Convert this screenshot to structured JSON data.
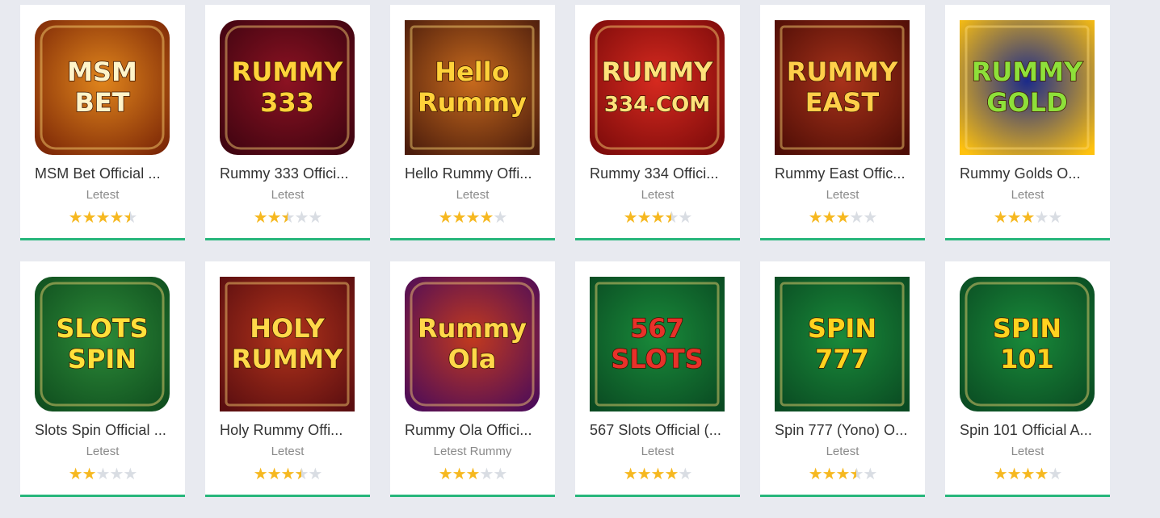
{
  "apps": [
    {
      "title": "MSM Bet Official ...",
      "sub": "Letest",
      "rating": 4.5,
      "art": "MSM BET",
      "bg1": "#7a2506",
      "bg2": "#e0851c",
      "fg": "#fff4c9",
      "shape": "round"
    },
    {
      "title": "Rummy 333 Offici...",
      "sub": "Letest",
      "rating": 2.5,
      "art": "RUMMY 333",
      "bg1": "#3d0410",
      "bg2": "#8c1222",
      "fg": "#ffd23a",
      "shape": "round"
    },
    {
      "title": "Hello Rummy Offi...",
      "sub": "Letest",
      "rating": 4,
      "art": "Hello Rummy",
      "bg1": "#4b1c0c",
      "bg2": "#c76a1d",
      "fg": "#ffd23a",
      "shape": "square"
    },
    {
      "title": "Rummy 334 Offici...",
      "sub": "Letest",
      "rating": 3.5,
      "art": "RUMMY 334.COM",
      "bg1": "#7a0a0a",
      "bg2": "#d62a1f",
      "fg": "#ffe27a",
      "shape": "round"
    },
    {
      "title": "Rummy East Offic...",
      "sub": "Letest",
      "rating": 3,
      "art": "RUMMY EAST",
      "bg1": "#4d0d06",
      "bg2": "#a8321a",
      "fg": "#ffcf4a",
      "shape": "square"
    },
    {
      "title": "Rummy Golds O...",
      "sub": "Letest",
      "rating": 3,
      "art": "RUMMY GOLD",
      "bg1": "#ffc20e",
      "bg2": "#1b2a8a",
      "fg": "#8ee03a",
      "shape": "square"
    },
    {
      "title": "Slots Spin Official ...",
      "sub": "Letest",
      "rating": 2,
      "art": "SLOTS SPIN",
      "bg1": "#0f4d1e",
      "bg2": "#2c8a38",
      "fg": "#ffe03a",
      "shape": "round"
    },
    {
      "title": "Holy Rummy Offi...",
      "sub": "Letest",
      "rating": 3.5,
      "art": "HOLY RUMMY",
      "bg1": "#5a0e10",
      "bg2": "#b2331b",
      "fg": "#ffd84a",
      "shape": "square"
    },
    {
      "title": "Rummy Ola Offici...",
      "sub": "Letest Rummy",
      "rating": 3,
      "art": "Rummy Ola",
      "bg1": "#4a0b5a",
      "bg2": "#c23a1e",
      "fg": "#ffd84a",
      "shape": "round"
    },
    {
      "title": "567 Slots Official (...",
      "sub": "Letest",
      "rating": 4,
      "art": "567 SLOTS",
      "bg1": "#0a4a22",
      "bg2": "#198a3a",
      "fg": "#e8312a",
      "shape": "square"
    },
    {
      "title": "Spin 777 (Yono) O...",
      "sub": "Letest",
      "rating": 3.5,
      "art": "SPIN 777",
      "bg1": "#0a4a22",
      "bg2": "#198a3a",
      "fg": "#ffd21f",
      "shape": "square"
    },
    {
      "title": "Spin 101 Official A...",
      "sub": "Letest",
      "rating": 4,
      "art": "SPIN 101",
      "bg1": "#0a4a22",
      "bg2": "#198a3a",
      "fg": "#ffd21f",
      "shape": "round"
    }
  ],
  "colors": {
    "accent": "#27b67b",
    "star": "#f6b820",
    "star_empty": "#d9dde3"
  }
}
